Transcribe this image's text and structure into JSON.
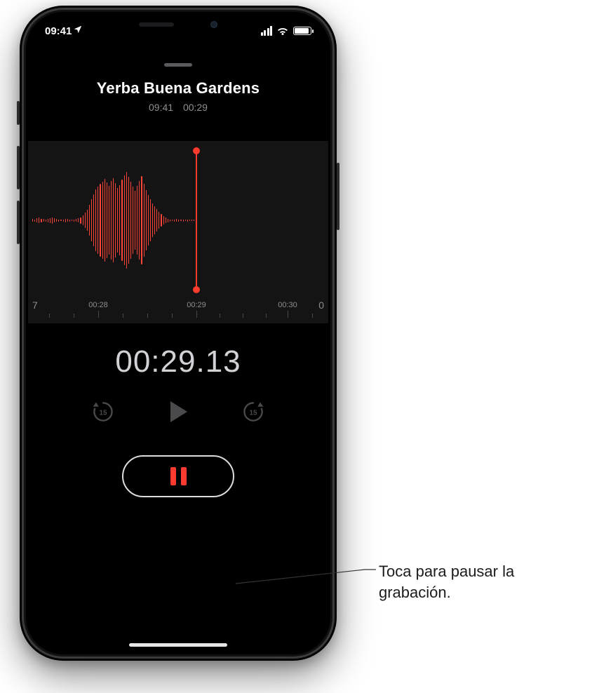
{
  "status": {
    "time": "09:41",
    "location_arrow": true
  },
  "recording": {
    "title": "Yerba Buena Gardens",
    "start_clock": "09:41",
    "duration_short": "00:29",
    "elapsed_timer": "00:29.13",
    "ruler": {
      "left_edge": "7",
      "labels": [
        "00:28",
        "00:29",
        "00:30"
      ],
      "right_edge": "0"
    }
  },
  "callout": {
    "text": "Toca para pausar la grabación."
  }
}
